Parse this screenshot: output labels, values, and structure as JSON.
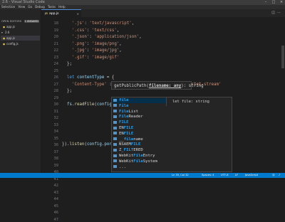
{
  "window": {
    "title": "2.6 - Visual Studio Code"
  },
  "menu": [
    "Selection",
    "View",
    "Go",
    "Debug",
    "Tasks",
    "Help"
  ],
  "sidebar": {
    "open_editors_label": "OPEN EDITORS",
    "unsaved_badge": "1 UNSAVED",
    "open_file": "app.js",
    "folder": "2.6",
    "files": [
      "app.js",
      "config.js"
    ]
  },
  "tab": {
    "icon": "JS",
    "label": "app.js",
    "close": "×"
  },
  "editor": {
    "line_numbers": [
      "18",
      "19",
      "20",
      "21",
      "22",
      "23",
      "24",
      "25",
      "26",
      "27",
      "28",
      "29",
      "30",
      "31",
      "32",
      "33",
      "34",
      "35",
      "36",
      "37",
      "38",
      "39",
      "40",
      "41",
      "42",
      "43",
      "44",
      "45",
      "46",
      "47"
    ]
  },
  "param_hint": {
    "prefix": "getPublicPath(",
    "param": "filename: any",
    "suffix": "): string"
  },
  "suggest": {
    "items": [
      {
        "match": "file",
        "rest": ""
      },
      {
        "match": "File",
        "rest": ""
      },
      {
        "match": "File",
        "rest": "List"
      },
      {
        "match": "File",
        "rest": "Reader"
      },
      {
        "match": "FILE",
        "rest": ""
      },
      {
        "pre": "EN",
        "match": "FILE",
        "rest": ""
      },
      {
        "pre": "EN",
        "match": "FILE",
        "rest": ""
      },
      {
        "pre": "__",
        "match": "file",
        "rest": "name"
      },
      {
        "pre": "NSAEM",
        "match": "FILE",
        "rest": ""
      },
      {
        "pre": "Z_",
        "match": "FILT",
        "rest": "ERED"
      },
      {
        "pre": "WebKit",
        "match": "File",
        "rest": "Entry"
      },
      {
        "pre": "WebKit",
        "match": "File",
        "rest": "System"
      },
      {
        "pre": "...",
        "match": "",
        "rest": ""
      }
    ],
    "detail": "let file: string"
  },
  "status": {
    "position": "Ln 35, Col 32",
    "spaces": "Spaces: 4",
    "encoding": "UTF-8",
    "eol": "LF",
    "language": "JavaScript"
  },
  "colors": {
    "accent": "#007acc",
    "background": "#1e1e1e",
    "sidebar": "#252526",
    "string": "#ce9178",
    "keyword": "#569cd6"
  }
}
